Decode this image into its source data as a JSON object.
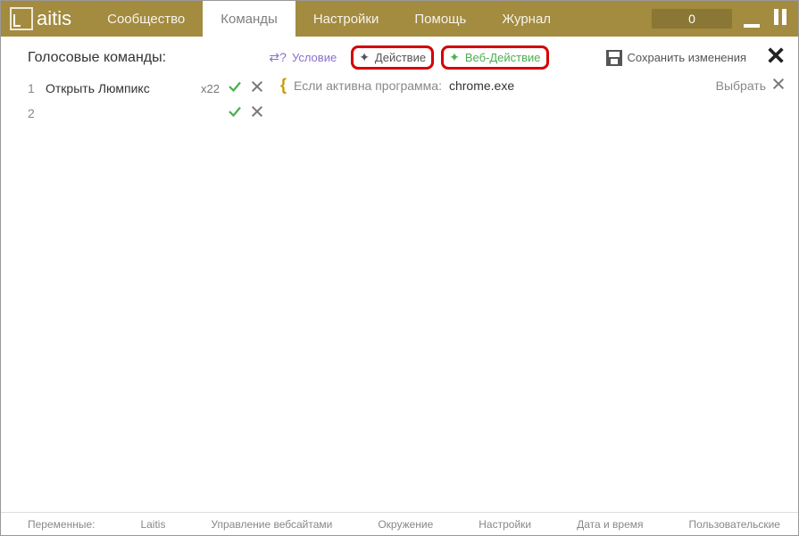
{
  "app": {
    "name": "aitis"
  },
  "tabs": {
    "community": "Сообщество",
    "commands": "Команды",
    "settings": "Настройки",
    "help": "Помощь",
    "journal": "Журнал"
  },
  "counter": "0",
  "toolbar": {
    "title": "Голосовые команды:",
    "condition": "Условие",
    "action": "Действие",
    "webaction": "Веб-Действие",
    "save": "Сохранить изменения"
  },
  "commands": [
    {
      "n": "1",
      "text": "Открыть Люмпикс",
      "count": "x22"
    },
    {
      "n": "2",
      "text": "",
      "count": ""
    }
  ],
  "condition": {
    "label": "Если активна программа:",
    "value": "chrome.exe",
    "choose": "Выбрать"
  },
  "footer": {
    "label": "Переменные:",
    "items": [
      "Laitis",
      "Управление вебсайтами",
      "Окружение",
      "Настройки",
      "Дата и время",
      "Пользовательские"
    ]
  }
}
